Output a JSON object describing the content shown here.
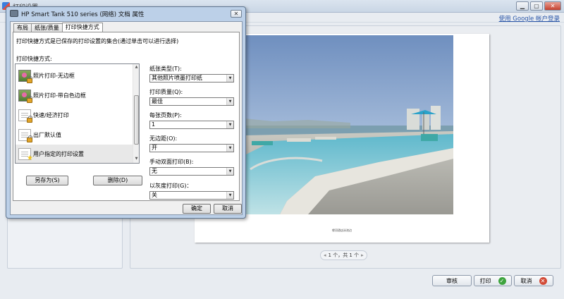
{
  "app": {
    "title": "打印设置",
    "account_link": "使用 Google 帐户登录"
  },
  "preview": {
    "caption": "缘羽酒店泳池边",
    "pager": {
      "prev": "◂",
      "text": "1 个，共 1 个",
      "next": "▸"
    }
  },
  "bottom_buttons": {
    "options": "审核",
    "print": "打印",
    "cancel": "取消"
  },
  "dialog": {
    "title": "HP Smart Tank 510 series (网络) 文档 属性",
    "close": "✕",
    "tabs": [
      "布局",
      "纸张/质量",
      "打印快捷方式"
    ],
    "active_tab": "打印快捷方式",
    "description": "打印快捷方式是已保存的打印设置的集合(通过单击可以进行选择)",
    "list_label": "打印快捷方式:",
    "shortcuts": [
      {
        "label": "照片打印-无边框",
        "icon": "photo-lock-icon"
      },
      {
        "label": "照片打印-带白色边框",
        "icon": "photo-lock-icon"
      },
      {
        "label": "快速/经济打印",
        "icon": "document-lock-icon"
      },
      {
        "label": "出厂默认值",
        "icon": "document-lock-icon"
      },
      {
        "label": "用户指定的打印设置",
        "icon": "document-star-icon",
        "selected": true
      }
    ],
    "save_as": "另存为(S)",
    "delete": "删除(D)",
    "fields": {
      "paper_type_label": "纸张类型(T):",
      "paper_type_value": "其他照片喷墨打印纸",
      "quality_label": "打印质量(Q):",
      "quality_value": "最佳",
      "pages_per_sheet_label": "每张页数(P):",
      "pages_per_sheet_value": "1",
      "borderless_label": "无边距(O):",
      "borderless_value": "开",
      "duplex_label": "手动双面打印(B):",
      "duplex_value": "无",
      "grayscale_label": "以灰度打印(G)：",
      "grayscale_value": "关"
    },
    "ok": "确定",
    "cancel": "取消"
  },
  "colors": {
    "dialog_frame": "#bcd0e8",
    "selected_row": "#e8e8e8",
    "pool_water": "#7fc8d6"
  }
}
